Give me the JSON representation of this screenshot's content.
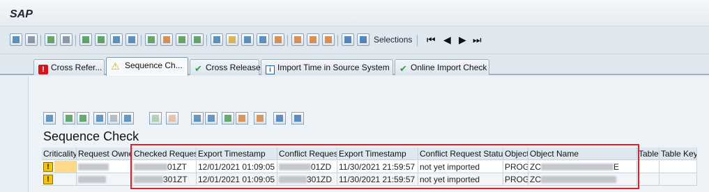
{
  "app": {
    "title": "SAP"
  },
  "toolbar": {
    "selections_label": "Selections",
    "nav": {
      "first": "⏮",
      "prev": "◀",
      "next": "▶",
      "last": "⏭"
    }
  },
  "tabs": [
    {
      "label": "Cross Refer...",
      "icon": "error-icon"
    },
    {
      "label": "Sequence Ch...",
      "icon": "warning-icon",
      "active": true
    },
    {
      "label": "Cross Release",
      "icon": "check-icon"
    },
    {
      "label": "Import Time in Source System",
      "icon": "info-icon"
    },
    {
      "label": "Online Import Check",
      "icon": "check-icon"
    }
  ],
  "section": {
    "title": "Sequence Check"
  },
  "table": {
    "columns": [
      "Criticality",
      "Request Owner",
      "Checked Request",
      "Export Timestamp",
      "Conflict Request",
      "Export Timestamp",
      "Conflict Request Status",
      "Object",
      "Object Name",
      "Table",
      "Table Key"
    ],
    "rows": [
      {
        "criticality": "!",
        "owner": "",
        "checked_prefix": "",
        "checked_suffix": "01ZT",
        "export_ts": "12/01/2021 01:09:05",
        "conflict_prefix": "",
        "conflict_suffix": "01ZD",
        "conflict_ts": "11/30/2021 21:59:57",
        "status": "not yet imported",
        "object": "PROG",
        "object_name_prefix": "ZC",
        "object_name_suffix": "E",
        "table": "",
        "table_key": ""
      },
      {
        "criticality": "!",
        "owner": "",
        "checked_prefix": "",
        "checked_suffix": "301ZT",
        "export_ts": "12/01/2021 01:09:05",
        "conflict_prefix": "",
        "conflict_suffix": "301ZD",
        "conflict_ts": "11/30/2021 21:59:57",
        "status": "not yet imported",
        "object": "PROG",
        "object_name_prefix": "ZC",
        "object_name_suffix": "",
        "table": "",
        "table_key": ""
      }
    ]
  },
  "colors": {
    "warning": "#f5c400",
    "highlight_box": "#e01f26",
    "error": "#d4161c",
    "ok": "#27a83a"
  }
}
